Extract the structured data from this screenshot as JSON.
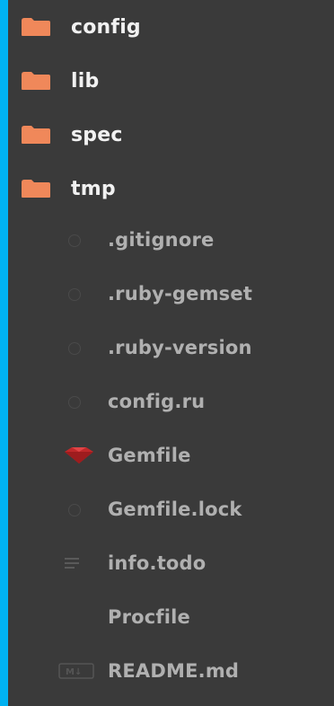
{
  "folders": [
    {
      "name": "config",
      "icon": "folder-icon"
    },
    {
      "name": "lib",
      "icon": "folder-icon"
    },
    {
      "name": "spec",
      "icon": "folder-icon"
    },
    {
      "name": "tmp",
      "icon": "folder-icon"
    }
  ],
  "files": [
    {
      "name": ".gitignore",
      "icon": "generic-file-icon"
    },
    {
      "name": ".ruby-gemset",
      "icon": "generic-file-icon"
    },
    {
      "name": ".ruby-version",
      "icon": "generic-file-icon"
    },
    {
      "name": "config.ru",
      "icon": "generic-file-icon"
    },
    {
      "name": "Gemfile",
      "icon": "ruby-gem-icon"
    },
    {
      "name": "Gemfile.lock",
      "icon": "generic-file-icon"
    },
    {
      "name": "info.todo",
      "icon": "text-lines-icon"
    },
    {
      "name": "Procfile",
      "icon": ""
    },
    {
      "name": "README.md",
      "icon": "markdown-icon"
    }
  ],
  "colors": {
    "background": "#00b2f2",
    "panel": "#3a3a3a",
    "folder": "#f0885a",
    "folder_text": "#f1f1f1",
    "file_text": "#b0b0b0",
    "gem": "#c0282a"
  }
}
